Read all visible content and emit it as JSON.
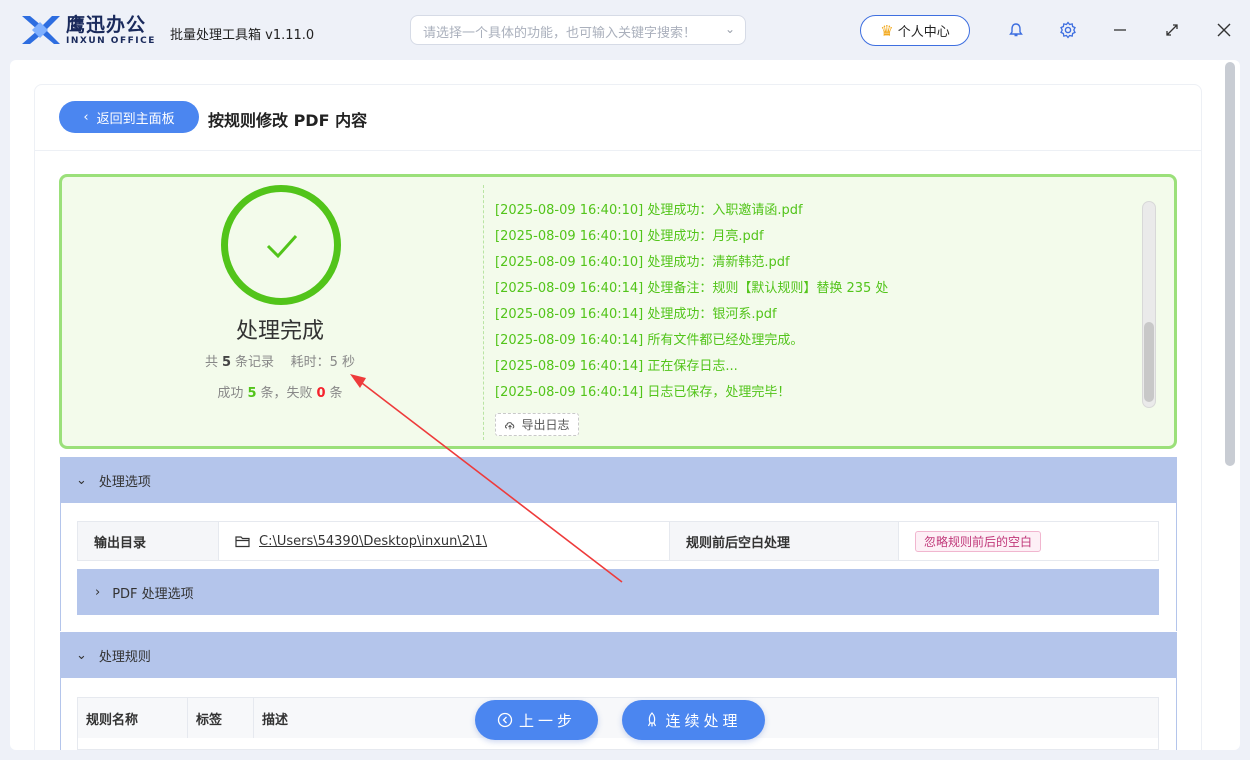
{
  "app": {
    "logo_cn": "鹰迅办公",
    "logo_en": "INXUN OFFICE",
    "title": "批量处理工具箱 v1.11.0",
    "search_placeholder": "请选择一个具体的功能，也可输入关键字搜索！",
    "user_center": "个人中心",
    "accent": "#4b86f0"
  },
  "header": {
    "back_label": "返回到主面板",
    "page_title": "按规则修改 PDF 内容"
  },
  "result": {
    "status": "处理完成",
    "total_prefix": "共",
    "total": "5",
    "total_suffix": "条记录",
    "time_prefix": "耗时：",
    "time": "5",
    "time_suffix": "秒",
    "success_prefix": "成功",
    "success": "5",
    "fail_prefix": "条，失败",
    "fail": "0",
    "fail_suffix": "条",
    "logs": [
      "[2025-08-09 16:40:10] 处理成功：入职邀请函.pdf",
      "[2025-08-09 16:40:10] 处理成功：月亮.pdf",
      "[2025-08-09 16:40:10] 处理成功：清新韩范.pdf",
      "[2025-08-09 16:40:14] 处理备注：规则【默认规则】替换 235 处",
      "[2025-08-09 16:40:14] 处理成功：银河系.pdf",
      "[2025-08-09 16:40:14] 所有文件都已经处理完成。",
      "[2025-08-09 16:40:14] 正在保存日志...",
      "[2025-08-09 16:40:14] 日志已保存，处理完毕！"
    ],
    "export_label": "导出日志",
    "success_color": "#52c41a",
    "fail_color": "#f5222d"
  },
  "options": {
    "section_label": "处理选项",
    "output_dir_label": "输出目录",
    "output_dir": "C:\\Users\\54390\\Desktop\\inxun\\2\\1\\",
    "whitespace_label": "规则前后空白处理",
    "whitespace_value": "忽略规则前后的空白",
    "pdf_options_label": "PDF 处理选项"
  },
  "rules": {
    "section_label": "处理规则",
    "columns": [
      "规则名称",
      "标签",
      "描述"
    ]
  },
  "footer": {
    "prev_label": "上一步",
    "continue_label": "连续处理"
  }
}
